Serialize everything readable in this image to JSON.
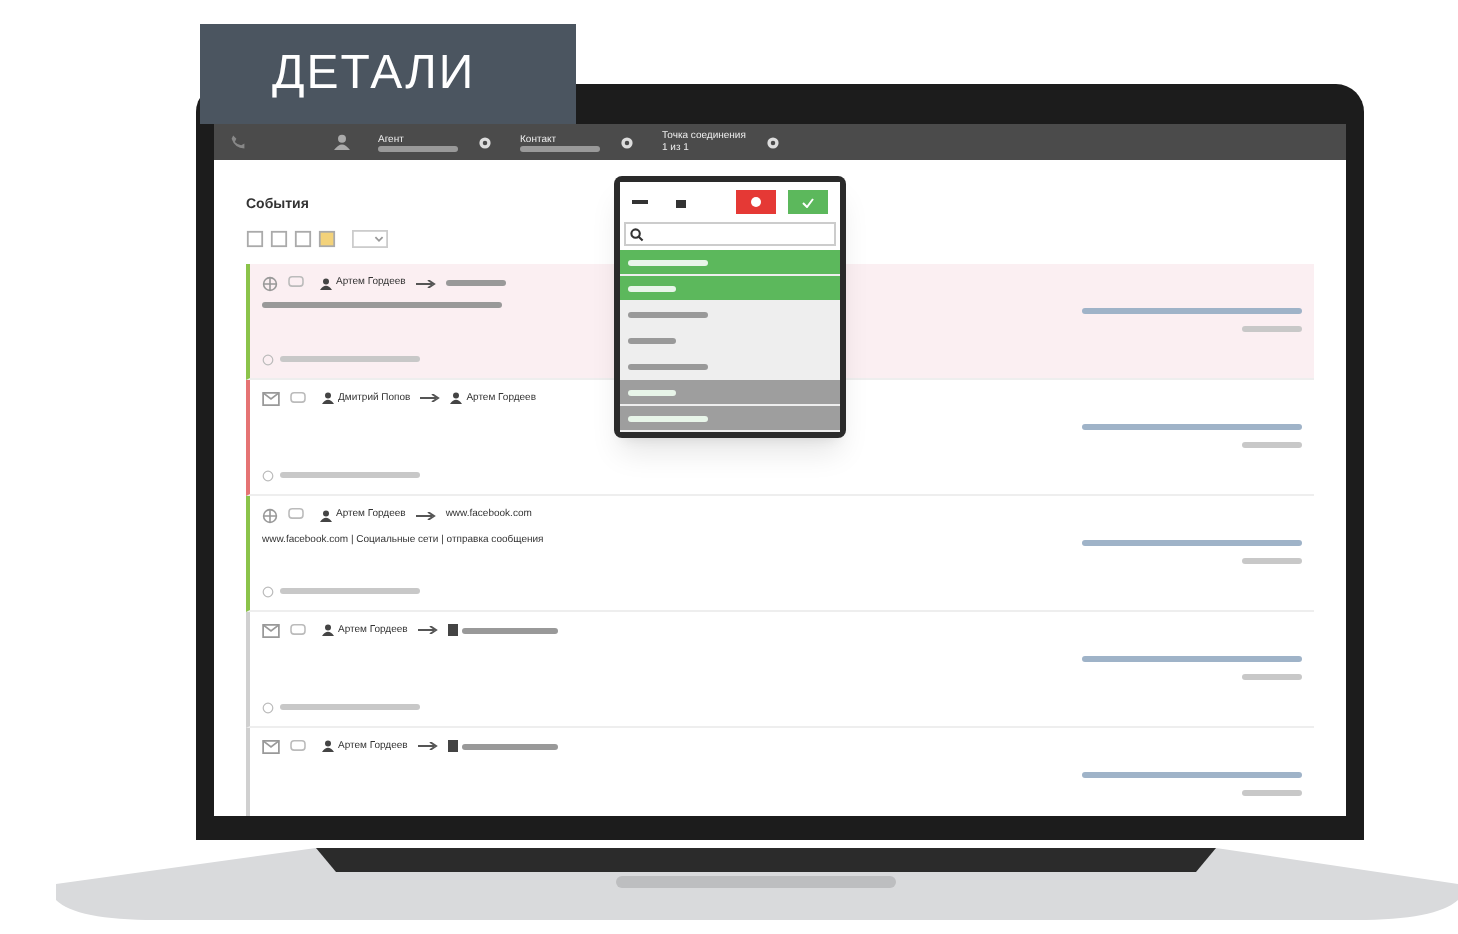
{
  "tag": "ДЕТАЛИ",
  "toolbar": {
    "fields": [
      {
        "label": "Агент"
      },
      {
        "label": "Контакт"
      },
      {
        "label": "Точка соединения",
        "value": "1 из 1"
      }
    ]
  },
  "events_title": "События",
  "events": [
    {
      "kind": "web",
      "color": "#8bc34a",
      "highlighted": true,
      "from": "Артем Гордеев",
      "to": {
        "kind": "site"
      },
      "description": false
    },
    {
      "kind": "email",
      "color": "#e57373",
      "highlighted": false,
      "from": "Дмитрий Попов",
      "to": {
        "kind": "person",
        "text": "Артем Гордеев"
      }
    },
    {
      "kind": "web",
      "color": "#8bc34a",
      "highlighted": false,
      "from": "Артем Гордеев",
      "to": {
        "kind": "site",
        "text": "www.facebook.com"
      },
      "description": "www.facebook.com | Социальные сети | отправка сообщения"
    },
    {
      "kind": "email",
      "color": "#d0d0d0",
      "highlighted": false,
      "from": "Артем Гордеев",
      "to": {
        "kind": "mail"
      }
    },
    {
      "kind": "email",
      "color": "#d0d0d0",
      "highlighted": false,
      "from": "Артем Гордеев",
      "to": {
        "kind": "mail"
      }
    }
  ],
  "popup": {
    "items": [
      {
        "selected": true
      },
      {
        "selected": true
      },
      {
        "selected": false,
        "kind": "light"
      },
      {
        "selected": false,
        "kind": "light"
      },
      {
        "selected": false,
        "kind": "light"
      },
      {
        "selected": false,
        "kind": "dark"
      },
      {
        "selected": false,
        "kind": "dark"
      }
    ]
  }
}
